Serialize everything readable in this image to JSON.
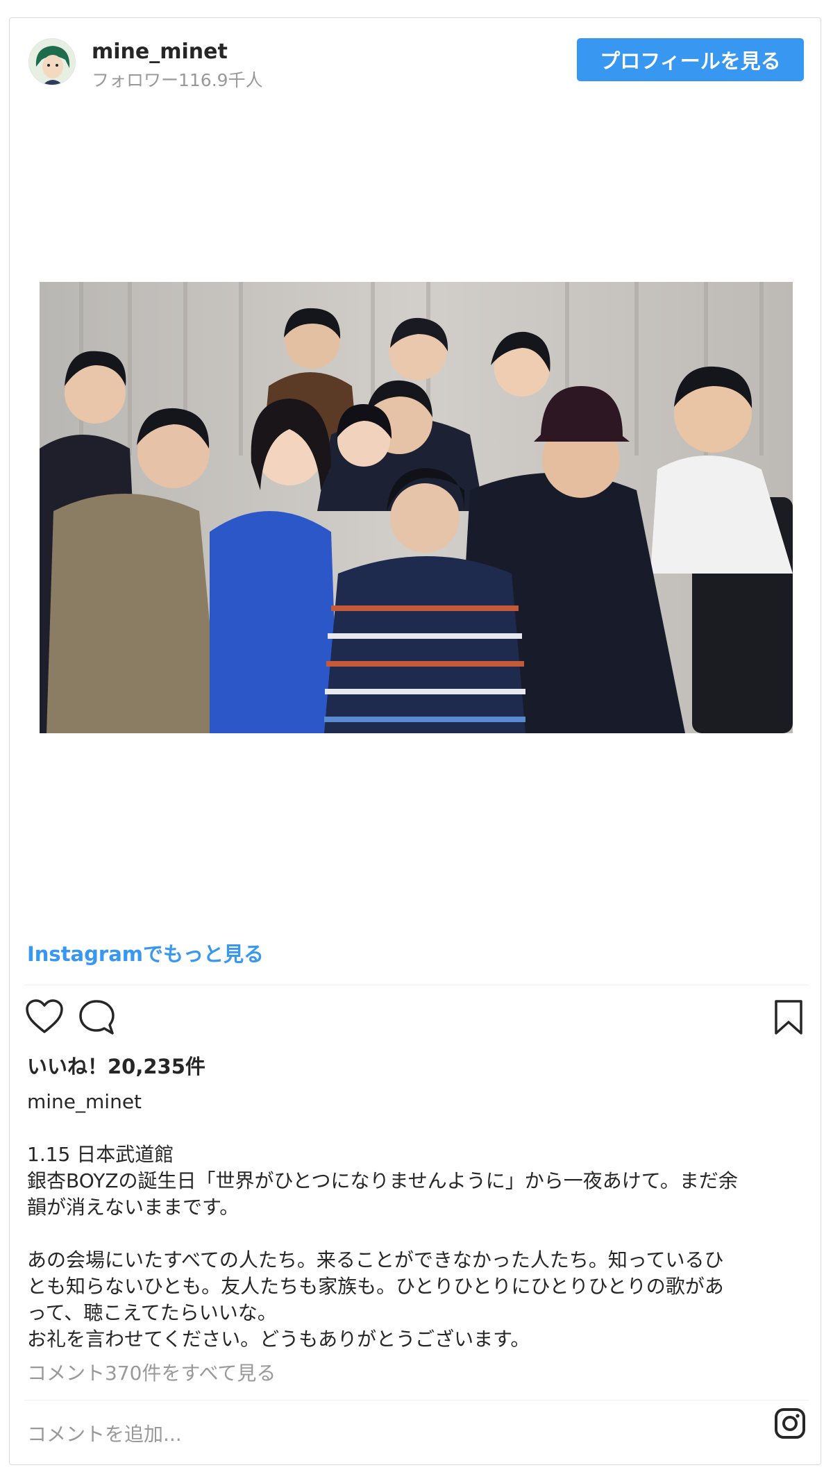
{
  "header": {
    "username": "mine_minet",
    "followers": "フォロワー116.9千人",
    "profile_button": "プロフィールを見る"
  },
  "photo": {
    "icon": "group-photo"
  },
  "more_link": "Instagramでもっと見る",
  "actions": {
    "like_icon": "heart-icon",
    "comment_icon": "comment-icon",
    "save_icon": "bookmark-icon"
  },
  "likes": "いいね！20,235件",
  "caption": {
    "username": "mine_minet",
    "lines": [
      "1.15 日本武道館",
      "銀杏BOYZの誕生日「世界がひとつになりませんように」から一夜あけて。まだ余",
      "韻が消えないままです。",
      "",
      "あの会場にいたすべての人たち。来ることができなかった人たち。知っているひ",
      "とも知らないひとも。友人たちも家族も。ひとりひとりにひとりひとりの歌があ",
      "って、聴こえてたらいいな。",
      "お礼を言わせてください。どうもありがとうございます。"
    ]
  },
  "view_comments": "コメント370件をすべて見る",
  "comment_placeholder": "コメントを追加...",
  "colors": {
    "accent": "#3897f0",
    "text": "#262626",
    "muted": "#999999",
    "border": "#dbdbdb"
  }
}
